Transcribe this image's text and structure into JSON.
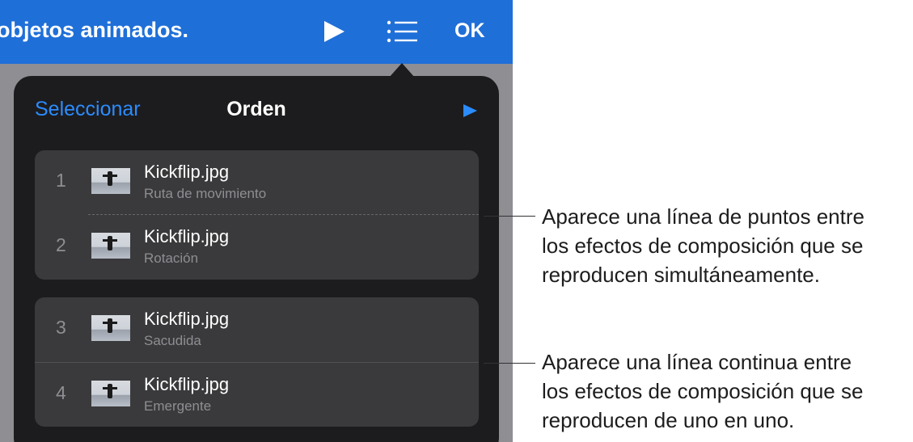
{
  "topbar": {
    "title": "objetos animados.",
    "ok_label": "OK",
    "color": "#1f6fd8"
  },
  "popover": {
    "select_label": "Seleccionar",
    "title": "Orden",
    "accent": "#2b8cff"
  },
  "builds": [
    {
      "number": "1",
      "name": "Kickflip.jpg",
      "effect": "Ruta de movimiento"
    },
    {
      "number": "2",
      "name": "Kickflip.jpg",
      "effect": "Rotación"
    },
    {
      "number": "3",
      "name": "Kickflip.jpg",
      "effect": "Sacudida"
    },
    {
      "number": "4",
      "name": "Kickflip.jpg",
      "effect": "Emergente"
    }
  ],
  "callouts": {
    "dotted": [
      "Aparece una línea de puntos entre",
      "los efectos de composición que se",
      "reproducen simultáneamente."
    ],
    "solid": [
      "Aparece una línea continua entre",
      "los efectos de composición que se",
      "reproducen de uno en uno."
    ]
  },
  "icons": {
    "play": "play-icon",
    "list": "list-icon",
    "thumbnail": "skater-thumbnail-icon"
  }
}
